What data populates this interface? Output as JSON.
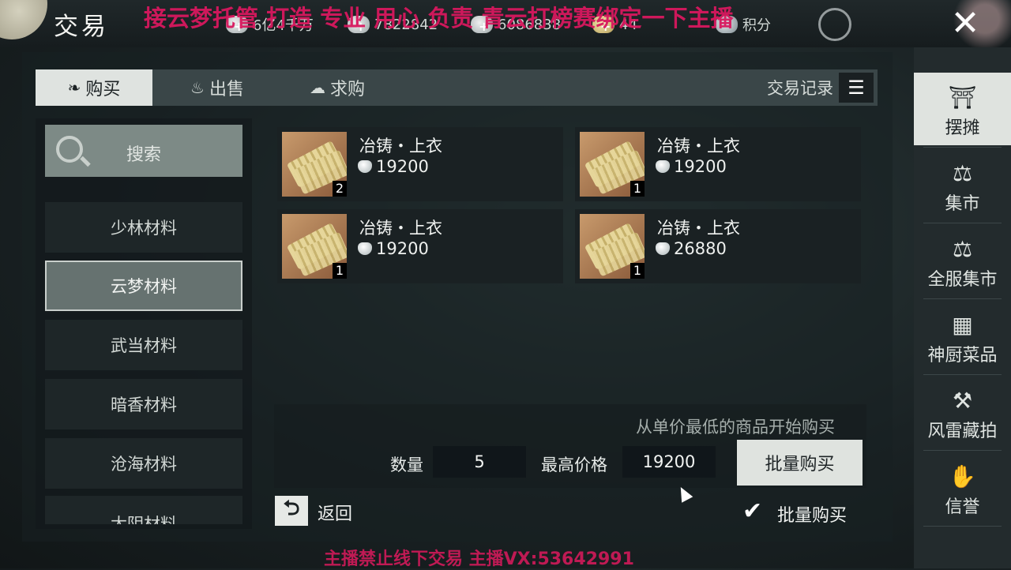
{
  "header": {
    "title": "交易",
    "currencies": [
      "6亿4千万",
      "7822842",
      "6086838",
      "44"
    ],
    "points_label": "积分"
  },
  "overlays": {
    "top_text": "接云梦托管 打造 专业 用心 负责  青云打榜赛绑定一下主播",
    "bottom_text": "主播禁止线下交易    主播VX:53642991"
  },
  "tabs": [
    "购买",
    "出售",
    "求购"
  ],
  "trade_record_label": "交易记录",
  "search_label": "搜索",
  "categories": [
    "少林材料",
    "云梦材料",
    "武当材料",
    "暗香材料",
    "沧海材料",
    "太阴材料"
  ],
  "items": [
    {
      "name": "冶铸・上衣",
      "price": "19200",
      "count": "2"
    },
    {
      "name": "冶铸・上衣",
      "price": "19200",
      "count": "1"
    },
    {
      "name": "冶铸・上衣",
      "price": "19200",
      "count": "1"
    },
    {
      "name": "冶铸・上衣",
      "price": "26880",
      "count": "1"
    }
  ],
  "purchase": {
    "hint": "从单价最低的商品开始购买",
    "quantity_label": "数量",
    "quantity": "5",
    "max_price_label": "最高价格",
    "max_price": "19200",
    "bulk_buy_button": "批量购买",
    "bulk_buy_checkbox": "批量购买"
  },
  "back_label": "返回",
  "sidebar": [
    "摆摊",
    "集市",
    "全服集市",
    "神厨菜品",
    "风雷藏拍",
    "信誉"
  ]
}
